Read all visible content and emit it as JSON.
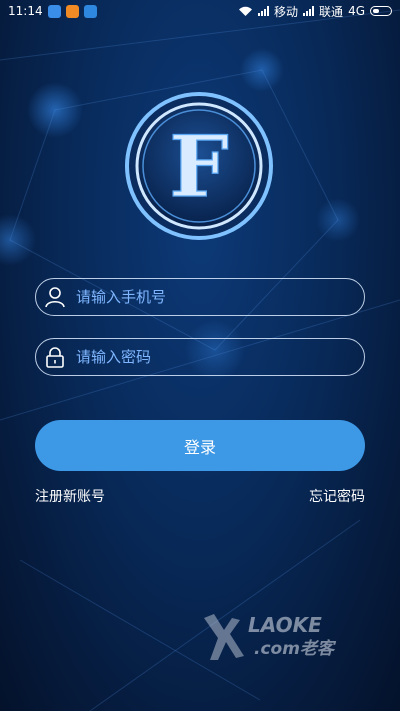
{
  "status_bar": {
    "time": "11:14",
    "carrier1": "移动",
    "carrier2": "联通",
    "network": "4G"
  },
  "login": {
    "phone_placeholder": "请输入手机号",
    "password_placeholder": "请输入密码",
    "login_button": "登录",
    "register_link": "注册新账号",
    "forgot_link": "忘记密码"
  },
  "logo": {
    "letter": "F"
  },
  "watermark": {
    "text_top": "LAOKE",
    "text_bottom": ".com老客"
  },
  "colors": {
    "accent": "#3d98e6",
    "placeholder": "#7fb6ff"
  }
}
